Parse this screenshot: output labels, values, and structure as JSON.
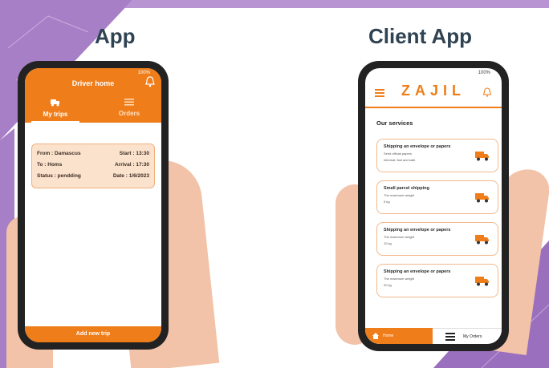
{
  "colors": {
    "accent": "#ef7d1a",
    "heading": "#2f4353",
    "corner_purple": "#a77fc6"
  },
  "headings": {
    "left": "App",
    "right": "Client App"
  },
  "driver": {
    "status_text": "100%",
    "title": "Driver home",
    "tabs": [
      {
        "label": "My trips",
        "icon": "truck-icon"
      },
      {
        "label": "Orders",
        "icon": "list-icon"
      }
    ],
    "trip": {
      "from_label": "From :",
      "from_value": "Damascus",
      "start_label": "Start :",
      "start_value": "13:30",
      "to_label": "To :",
      "to_value": "Homs",
      "arrival_label": "Arrival : 17:30",
      "status_label": "Status : pendding",
      "date_label": "Date :",
      "date_value": "1/6/2023"
    },
    "add_button": "Add new trip"
  },
  "client": {
    "status_text": "100%",
    "logo": "ZAJIL",
    "section_title": "Our services",
    "services": [
      {
        "title": "Shipping an envelope or papers",
        "sub": "Send official papers",
        "detail": "informal, fast and safe"
      },
      {
        "title": "Small parcel shipping",
        "sub": "The maximum weight",
        "detail": "5 kg"
      },
      {
        "title": "Shipping an envelope or papers",
        "sub": "The maximum weight",
        "detail": "10 kg"
      },
      {
        "title": "Shipping an envelope or papers",
        "sub": "The maximum weight",
        "detail": "20 kg"
      }
    ],
    "bottom_nav": {
      "home": "Home",
      "orders": "My Orders"
    }
  }
}
